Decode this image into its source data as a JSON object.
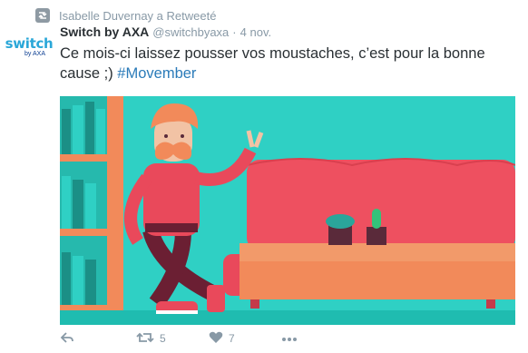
{
  "retweet": {
    "text": "Isabelle Duvernay a Retweeté",
    "icon": "retweet-icon"
  },
  "author": {
    "avatar_brand": "switch",
    "avatar_sub": "by AXA",
    "display_name": "Switch by AXA",
    "handle": "@switchbyaxa",
    "separator": "·",
    "date": "4 nov."
  },
  "tweet": {
    "text_line1": "Ce mois-ci laissez pousser vos moustaches, c’est pour la bonne",
    "text_line2": "cause ;)",
    "hashtag": "#Movember"
  },
  "media": {
    "description_icon": "movember-illustration",
    "colors": {
      "background": "#2fd0c4",
      "bookshelf": "#f28a5a",
      "sofa": "#ee5060",
      "character_shirt": "#e9495b",
      "character_hair": "#f28a5a",
      "table": "#f29a6a"
    }
  },
  "actions": {
    "reply_icon": "reply-icon",
    "retweet_icon": "retweet-icon",
    "retweet_count": "5",
    "like_icon": "heart-icon",
    "like_count": "7",
    "more_icon": "more-icon"
  }
}
